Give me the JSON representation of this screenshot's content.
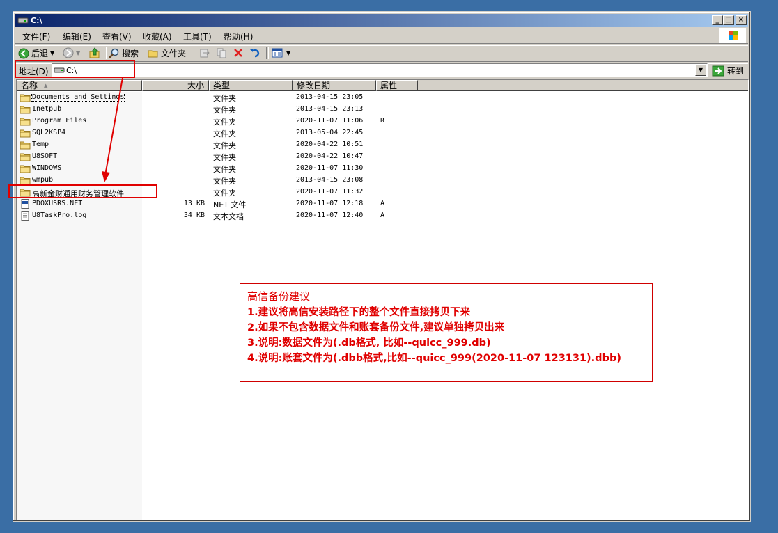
{
  "window": {
    "title": "C:\\"
  },
  "menu": [
    "文件(F)",
    "编辑(E)",
    "查看(V)",
    "收藏(A)",
    "工具(T)",
    "帮助(H)"
  ],
  "toolbar": {
    "back": "后退",
    "search": "搜索",
    "folders": "文件夹"
  },
  "address": {
    "label": "地址(D)",
    "value": "C:\\",
    "go": "转到"
  },
  "columns": {
    "name": "名称",
    "size": "大小",
    "type": "类型",
    "modified": "修改日期",
    "attrs": "属性"
  },
  "files": [
    {
      "name": "Documents and Settings",
      "size": "",
      "type": "文件夹",
      "modified": "2013-04-15 23:05",
      "attrs": "",
      "icon": "folder-icon"
    },
    {
      "name": "Inetpub",
      "size": "",
      "type": "文件夹",
      "modified": "2013-04-15 23:13",
      "attrs": "",
      "icon": "folder-icon"
    },
    {
      "name": "Program Files",
      "size": "",
      "type": "文件夹",
      "modified": "2020-11-07 11:06",
      "attrs": "R",
      "icon": "folder-icon"
    },
    {
      "name": "SQL2KSP4",
      "size": "",
      "type": "文件夹",
      "modified": "2013-05-04 22:45",
      "attrs": "",
      "icon": "folder-icon"
    },
    {
      "name": "Temp",
      "size": "",
      "type": "文件夹",
      "modified": "2020-04-22 10:51",
      "attrs": "",
      "icon": "folder-icon"
    },
    {
      "name": "U8SOFT",
      "size": "",
      "type": "文件夹",
      "modified": "2020-04-22 10:47",
      "attrs": "",
      "icon": "folder-icon"
    },
    {
      "name": "WINDOWS",
      "size": "",
      "type": "文件夹",
      "modified": "2020-11-07 11:30",
      "attrs": "",
      "icon": "folder-icon"
    },
    {
      "name": "wmpub",
      "size": "",
      "type": "文件夹",
      "modified": "2013-04-15 23:08",
      "attrs": "",
      "icon": "folder-icon"
    },
    {
      "name": "高新金财通用财务管理软件",
      "size": "",
      "type": "文件夹",
      "modified": "2020-11-07 11:32",
      "attrs": "",
      "icon": "folder-icon"
    },
    {
      "name": "PDOXUSRS.NET",
      "size": "13 KB",
      "type": "NET 文件",
      "modified": "2020-11-07 12:18",
      "attrs": "A",
      "icon": "net-file-icon"
    },
    {
      "name": "U8TaskPro.log",
      "size": "34 KB",
      "type": "文本文档",
      "modified": "2020-11-07 12:40",
      "attrs": "A",
      "icon": "text-file-icon"
    }
  ],
  "note": {
    "title": "高信备份建议",
    "lines": [
      "1.建议将高信安装路径下的整个文件直接拷贝下来",
      "2.如果不包含数据文件和账套备份文件,建议单独拷贝出来",
      "3.说明:数据文件为(.db格式,  比如--quicc_999.db)",
      "4.说明:账套文件为(.dbb格式,比如--quicc_999(2020-11-07 123131).dbb)"
    ]
  },
  "colors": {
    "desktop": "#3a6ea5",
    "highlight": "#e00000",
    "titlebar": "#0a246a"
  }
}
